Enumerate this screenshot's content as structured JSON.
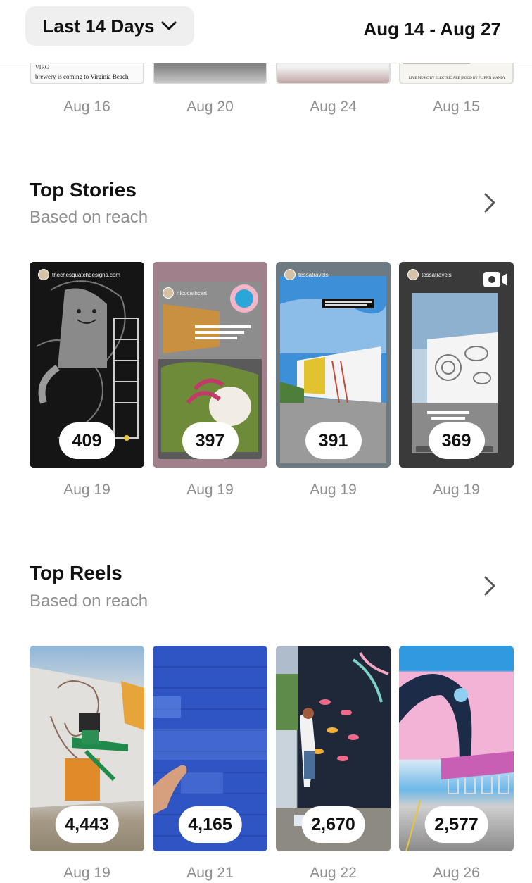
{
  "header": {
    "range_label": "Last 14 Days",
    "date_range": "Aug 14 - Aug 27"
  },
  "top_posts": {
    "dates": [
      "Aug 16",
      "Aug 20",
      "Aug 24",
      "Aug 15"
    ],
    "card1_text_a": "VIRG",
    "card1_text_b": "brewery is coming to Virginia Beach,",
    "card4_text": "LIVE MUSIC BY ELECTRIC ARE | FOOD BY FLIPPIN MANDY"
  },
  "top_stories": {
    "title": "Top Stories",
    "subtitle": "Based on reach",
    "items": [
      {
        "value": "409",
        "date": "Aug 19",
        "handle": "thechesquatchdesigns.com"
      },
      {
        "value": "397",
        "date": "Aug 19",
        "handle": "nicocathcart"
      },
      {
        "value": "391",
        "date": "Aug 19",
        "handle": "tessatravels"
      },
      {
        "value": "369",
        "date": "Aug 19",
        "handle": "tessatravels"
      }
    ]
  },
  "top_reels": {
    "title": "Top Reels",
    "subtitle": "Based on reach",
    "items": [
      {
        "value": "4,443",
        "date": "Aug 19"
      },
      {
        "value": "4,165",
        "date": "Aug 21"
      },
      {
        "value": "2,670",
        "date": "Aug 22"
      },
      {
        "value": "2,577",
        "date": "Aug 26"
      }
    ]
  },
  "colors": {
    "accent_text": "#111111",
    "muted_text": "#8e8e8e",
    "pill_bg": "#ffffff",
    "button_bg": "#efefef"
  },
  "icons": {
    "range_dropdown": "chevron-down-icon",
    "section_more": "chevron-right-icon",
    "story_video": "video-camera-icon"
  }
}
